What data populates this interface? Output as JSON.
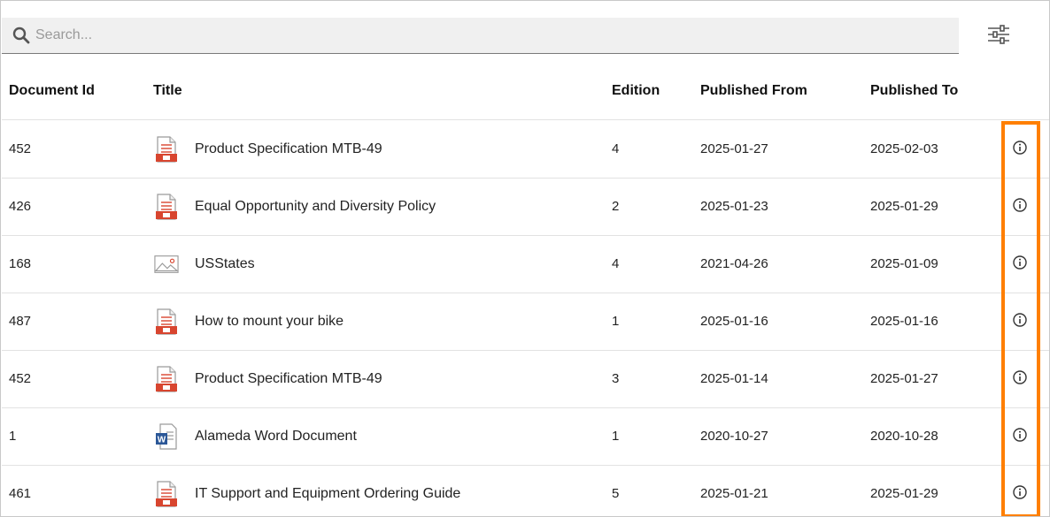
{
  "search": {
    "placeholder": "Search..."
  },
  "columns": {
    "document_id": "Document Id",
    "title": "Title",
    "edition": "Edition",
    "published_from": "Published From",
    "published_to": "Published To"
  },
  "rows": [
    {
      "id": "452",
      "icon": "pdf-document-icon",
      "title": "Product Specification MTB-49",
      "edition": "4",
      "from": "2025-01-27",
      "to": "2025-02-03"
    },
    {
      "id": "426",
      "icon": "pdf-document-icon",
      "title": "Equal Opportunity and Diversity Policy",
      "edition": "2",
      "from": "2025-01-23",
      "to": "2025-01-29"
    },
    {
      "id": "168",
      "icon": "image-file-icon",
      "title": "USStates",
      "edition": "4",
      "from": "2021-04-26",
      "to": "2025-01-09"
    },
    {
      "id": "487",
      "icon": "pdf-document-icon",
      "title": "How to mount your bike",
      "edition": "1",
      "from": "2025-01-16",
      "to": "2025-01-16"
    },
    {
      "id": "452",
      "icon": "pdf-document-icon",
      "title": "Product Specification MTB-49",
      "edition": "3",
      "from": "2025-01-14",
      "to": "2025-01-27"
    },
    {
      "id": "1",
      "icon": "word-document-icon",
      "title": "Alameda Word Document",
      "edition": "1",
      "from": "2020-10-27",
      "to": "2020-10-28"
    },
    {
      "id": "461",
      "icon": "pdf-document-icon",
      "title": "IT Support and Equipment Ordering Guide",
      "edition": "5",
      "from": "2025-01-21",
      "to": "2025-01-29"
    }
  ],
  "colors": {
    "highlight": "#ff7f00",
    "pdf_icon": "#d8452f",
    "word_icon": "#2b5797"
  }
}
